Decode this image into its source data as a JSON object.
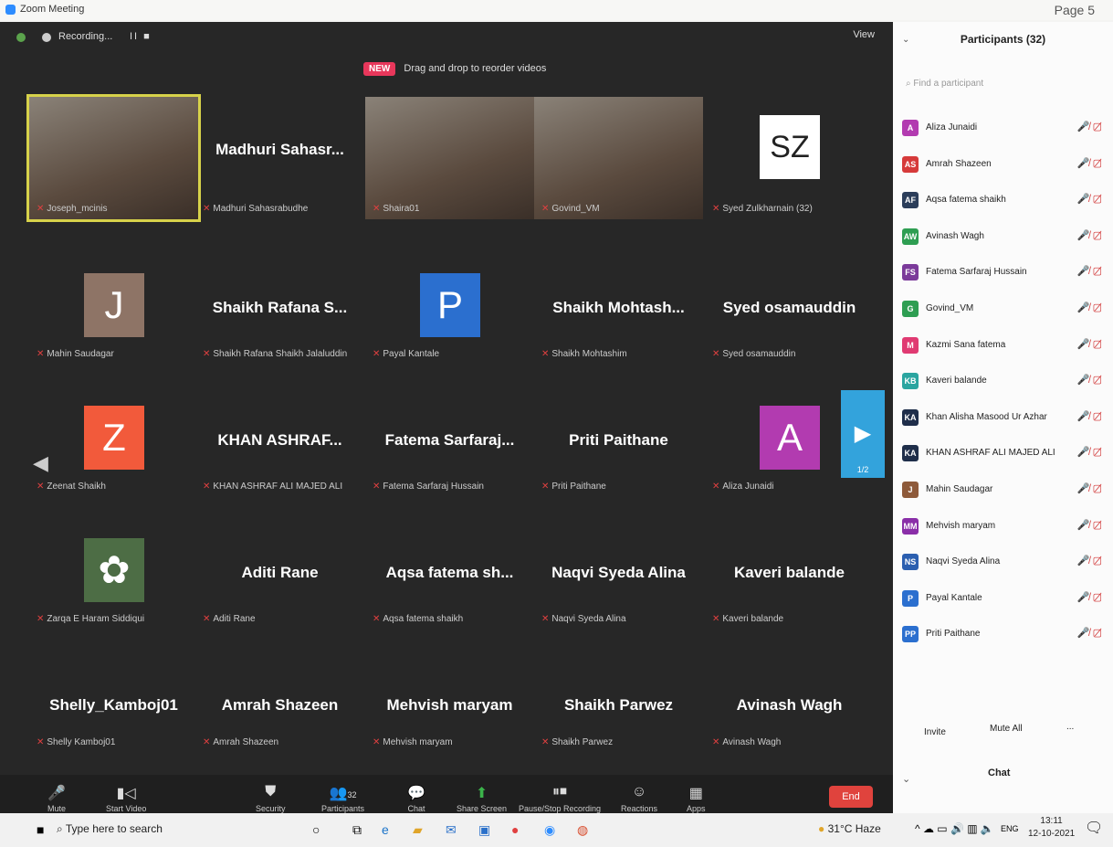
{
  "window": {
    "title": "Zoom Meeting",
    "page_mark": "Page 5"
  },
  "topbar": {
    "recording_label": "Recording...",
    "pause_label": "II ■",
    "view_label": "View"
  },
  "banner": {
    "badge": "NEW",
    "text": "Drag and drop to reorder videos"
  },
  "tiles": [
    {
      "big": "",
      "small": "Joseph_mcinis",
      "camera": true,
      "active": true
    },
    {
      "big": "Madhuri Sahasr...",
      "small": "Madhuri Sahasrabudhe"
    },
    {
      "big": "",
      "small": "Shaira01",
      "camera": true
    },
    {
      "big": "",
      "small": "Govind_VM",
      "camera": true
    },
    {
      "big": "",
      "small": "Syed Zulkharnain (32)",
      "avatar": "SZ",
      "avatar_color": "#ffffff"
    },
    {
      "big": "",
      "small": "Mahin Saudagar",
      "avatar": "J",
      "avatar_color": "#8e7466"
    },
    {
      "big": "Shaikh Rafana S...",
      "small": "Shaikh Rafana Shaikh Jalaluddin"
    },
    {
      "big": "",
      "small": "Payal Kantale",
      "avatar": "P",
      "avatar_color": "#2b6fcf"
    },
    {
      "big": "Shaikh Mohtash...",
      "small": "Shaikh Mohtashim"
    },
    {
      "big": "Syed osamauddin",
      "small": "Syed osamauddin"
    },
    {
      "big": "",
      "small": "Zeenat Shaikh",
      "avatar": "Z",
      "avatar_color": "#f25a3b"
    },
    {
      "big": "KHAN ASHRAF...",
      "small": "KHAN ASHRAF ALI MAJED ALI"
    },
    {
      "big": "Fatema Sarfaraj...",
      "small": "Fatema Sarfaraj Hussain"
    },
    {
      "big": "Priti Paithane",
      "small": "Priti Paithane"
    },
    {
      "big": "",
      "small": "Aliza Junaidi",
      "avatar": "A",
      "avatar_color": "#b23bb0"
    },
    {
      "big": "",
      "small": "Zarqa E Haram Siddiqui",
      "avatar": "✿",
      "avatar_color": "#4d6d45"
    },
    {
      "big": "Aditi Rane",
      "small": "Aditi Rane"
    },
    {
      "big": "Aqsa fatema sh...",
      "small": "Aqsa fatema shaikh"
    },
    {
      "big": "Naqvi Syeda Alina",
      "small": "Naqvi Syeda Alina"
    },
    {
      "big": "Kaveri balande",
      "small": "Kaveri balande"
    },
    {
      "big": "Shelly_Kamboj01",
      "small": "Shelly Kamboj01"
    },
    {
      "big": "Amrah Shazeen",
      "small": "Amrah Shazeen"
    },
    {
      "big": "Mehvish maryam",
      "small": "Mehvish maryam"
    },
    {
      "big": "Shaikh Parwez",
      "small": "Shaikh Parwez"
    },
    {
      "big": "Avinash Wagh",
      "small": "Avinash Wagh"
    }
  ],
  "nav": {
    "right_label": "1/2"
  },
  "toolbar": {
    "mute": "Mute",
    "start_video": "Start Video",
    "security": "Security",
    "participants": "Participants",
    "participants_count": "32",
    "chat": "Chat",
    "share": "Share Screen",
    "record": "Pause/Stop Recording",
    "reactions": "Reactions",
    "apps": "Apps",
    "end": "End"
  },
  "panel": {
    "title": "Participants (32)",
    "search_placeholder": "Find a participant",
    "participants": [
      {
        "initials": "A",
        "name": "Aliza Junaidi",
        "color": "#b23bb0"
      },
      {
        "initials": "AS",
        "name": "Amrah Shazeen",
        "color": "#d63a3a"
      },
      {
        "initials": "AF",
        "name": "Aqsa fatema shaikh",
        "color": "#2b3d5a"
      },
      {
        "initials": "AW",
        "name": "Avinash Wagh",
        "color": "#2e9e52"
      },
      {
        "initials": "FS",
        "name": "Fatema Sarfaraj Hussain",
        "color": "#7b3a9a"
      },
      {
        "initials": "G",
        "name": "Govind_VM",
        "color": "#2e9e52"
      },
      {
        "initials": "M",
        "name": "Kazmi Sana fatema",
        "color": "#e03a72"
      },
      {
        "initials": "KB",
        "name": "Kaveri balande",
        "color": "#2aa5a0"
      },
      {
        "initials": "KA",
        "name": "Khan Alisha Masood Ur Azhar",
        "color": "#1f2e4a"
      },
      {
        "initials": "KA",
        "name": "KHAN ASHRAF ALI MAJED ALI",
        "color": "#1f2e4a"
      },
      {
        "initials": "J",
        "name": "Mahin Saudagar",
        "color": "#8e5a3a"
      },
      {
        "initials": "MM",
        "name": "Mehvish maryam",
        "color": "#8a2ea8"
      },
      {
        "initials": "NS",
        "name": "Naqvi Syeda Alina",
        "color": "#2b5fb0"
      },
      {
        "initials": "P",
        "name": "Payal Kantale",
        "color": "#2b6fcf"
      },
      {
        "initials": "PP",
        "name": "Priti Paithane",
        "color": "#2b6fcf"
      }
    ],
    "invite": "Invite",
    "mute_all": "Mute All",
    "more": "...",
    "chat_header": "Chat"
  },
  "taskbar": {
    "search": "Type here to search",
    "weather": "31°C Haze",
    "lang": "ENG",
    "time": "13:11",
    "date": "12-10-2021"
  }
}
